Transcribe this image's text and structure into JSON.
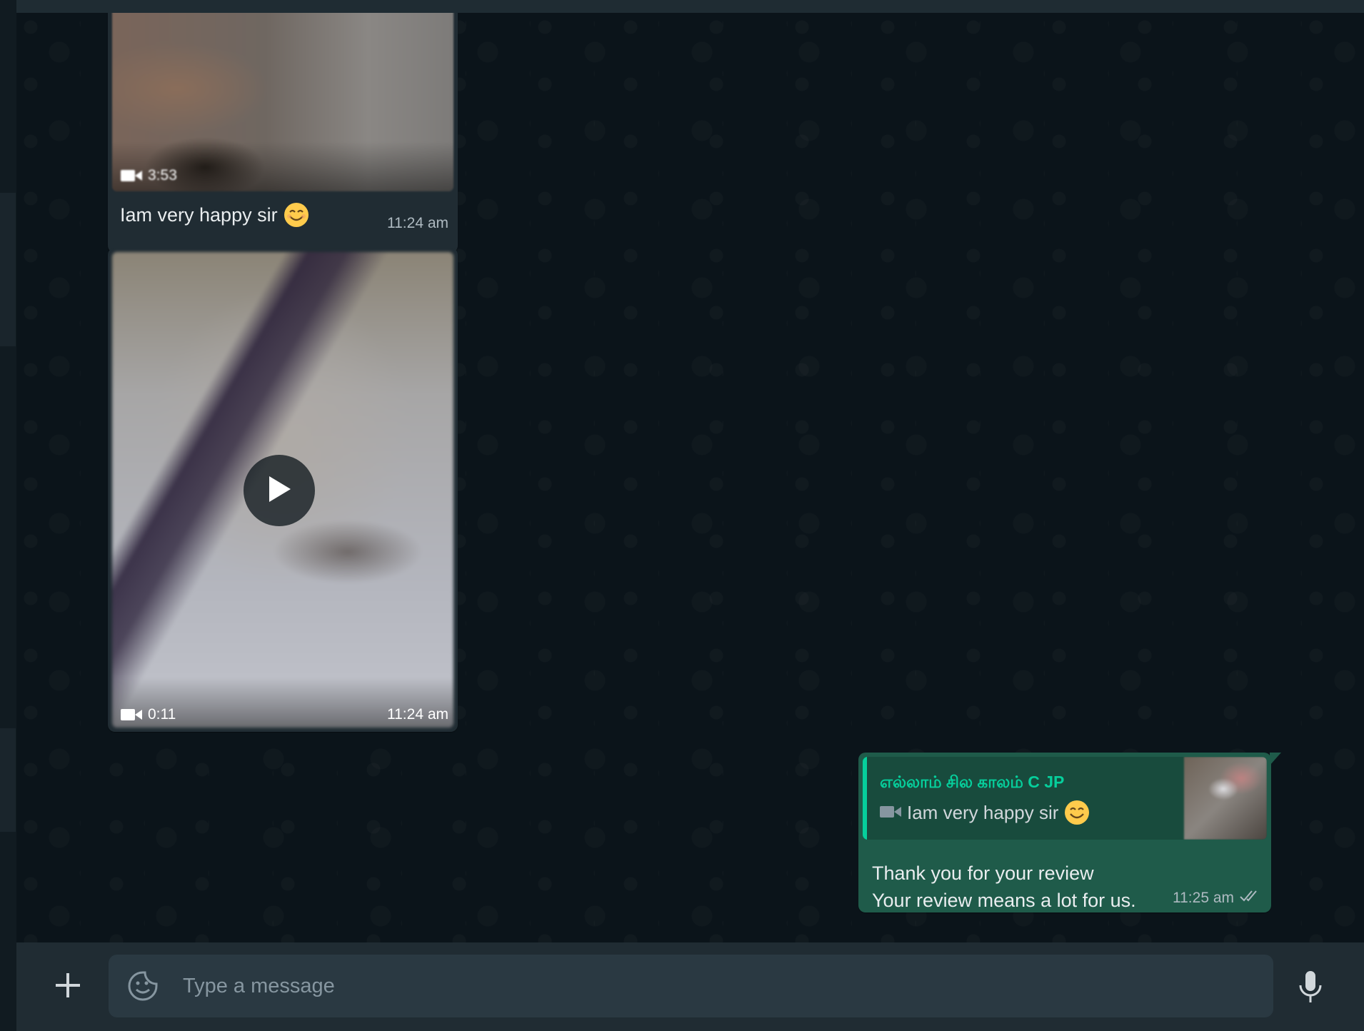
{
  "colors": {
    "chat_background": "#0b141a",
    "incoming_bubble": "#202c33",
    "outgoing_bubble": "#1f5b4a",
    "quote_accent": "#06cf9c",
    "footer": "#202c33",
    "input_background": "#2a3942"
  },
  "messages": [
    {
      "direction": "incoming",
      "type": "video",
      "duration": "3:53",
      "caption": "Iam very happy sir",
      "emoji": "smiling-face-icon",
      "time": "11:24 am"
    },
    {
      "direction": "incoming",
      "type": "video",
      "duration": "0:11",
      "time": "11:24 am",
      "overlay_icon": "play-icon"
    },
    {
      "direction": "outgoing",
      "type": "text",
      "quoted": {
        "author": "எல்லாம் சில காலம் C JP",
        "text": "Iam very happy sir",
        "icon": "video-icon",
        "emoji": "smiling-face-icon"
      },
      "lines": [
        "Thank you for your review",
        "Your review means a lot for us."
      ],
      "time": "11:25 am",
      "status_icon": "double-check-icon"
    }
  ],
  "composer": {
    "placeholder": "Type a message",
    "attach_icon": "plus-icon",
    "sticker_icon": "sticker-icon",
    "mic_icon": "microphone-icon"
  }
}
